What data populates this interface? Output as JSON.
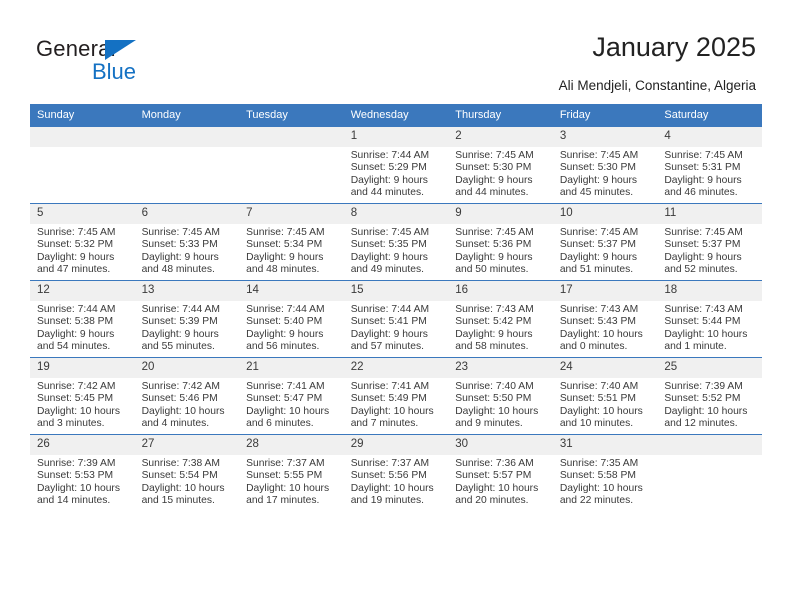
{
  "logo": {
    "word_top": "General",
    "word_bottom": "Blue",
    "triangle_icon": "triangle-icon",
    "brand_color": "#1471c3"
  },
  "header": {
    "title": "January 2025",
    "subtitle": "Ali Mendjeli, Constantine, Algeria"
  },
  "theme": {
    "header_blue": "#3b78bd",
    "daynum_band": "#f0f0f0",
    "text": "#3a3a3a"
  },
  "calendar": {
    "weekday_headers": [
      "Sunday",
      "Monday",
      "Tuesday",
      "Wednesday",
      "Thursday",
      "Friday",
      "Saturday"
    ],
    "labels": {
      "sunrise": "Sunrise:",
      "sunset": "Sunset:",
      "daylight": "Daylight:"
    },
    "weeks": [
      [
        {
          "day": ""
        },
        {
          "day": ""
        },
        {
          "day": ""
        },
        {
          "day": "1",
          "sunrise": "Sunrise: 7:44 AM",
          "sunset": "Sunset: 5:29 PM",
          "daylight_line1": "Daylight: 9 hours",
          "daylight_line2": "and 44 minutes."
        },
        {
          "day": "2",
          "sunrise": "Sunrise: 7:45 AM",
          "sunset": "Sunset: 5:30 PM",
          "daylight_line1": "Daylight: 9 hours",
          "daylight_line2": "and 44 minutes."
        },
        {
          "day": "3",
          "sunrise": "Sunrise: 7:45 AM",
          "sunset": "Sunset: 5:30 PM",
          "daylight_line1": "Daylight: 9 hours",
          "daylight_line2": "and 45 minutes."
        },
        {
          "day": "4",
          "sunrise": "Sunrise: 7:45 AM",
          "sunset": "Sunset: 5:31 PM",
          "daylight_line1": "Daylight: 9 hours",
          "daylight_line2": "and 46 minutes."
        }
      ],
      [
        {
          "day": "5",
          "sunrise": "Sunrise: 7:45 AM",
          "sunset": "Sunset: 5:32 PM",
          "daylight_line1": "Daylight: 9 hours",
          "daylight_line2": "and 47 minutes."
        },
        {
          "day": "6",
          "sunrise": "Sunrise: 7:45 AM",
          "sunset": "Sunset: 5:33 PM",
          "daylight_line1": "Daylight: 9 hours",
          "daylight_line2": "and 48 minutes."
        },
        {
          "day": "7",
          "sunrise": "Sunrise: 7:45 AM",
          "sunset": "Sunset: 5:34 PM",
          "daylight_line1": "Daylight: 9 hours",
          "daylight_line2": "and 48 minutes."
        },
        {
          "day": "8",
          "sunrise": "Sunrise: 7:45 AM",
          "sunset": "Sunset: 5:35 PM",
          "daylight_line1": "Daylight: 9 hours",
          "daylight_line2": "and 49 minutes."
        },
        {
          "day": "9",
          "sunrise": "Sunrise: 7:45 AM",
          "sunset": "Sunset: 5:36 PM",
          "daylight_line1": "Daylight: 9 hours",
          "daylight_line2": "and 50 minutes."
        },
        {
          "day": "10",
          "sunrise": "Sunrise: 7:45 AM",
          "sunset": "Sunset: 5:37 PM",
          "daylight_line1": "Daylight: 9 hours",
          "daylight_line2": "and 51 minutes."
        },
        {
          "day": "11",
          "sunrise": "Sunrise: 7:45 AM",
          "sunset": "Sunset: 5:37 PM",
          "daylight_line1": "Daylight: 9 hours",
          "daylight_line2": "and 52 minutes."
        }
      ],
      [
        {
          "day": "12",
          "sunrise": "Sunrise: 7:44 AM",
          "sunset": "Sunset: 5:38 PM",
          "daylight_line1": "Daylight: 9 hours",
          "daylight_line2": "and 54 minutes."
        },
        {
          "day": "13",
          "sunrise": "Sunrise: 7:44 AM",
          "sunset": "Sunset: 5:39 PM",
          "daylight_line1": "Daylight: 9 hours",
          "daylight_line2": "and 55 minutes."
        },
        {
          "day": "14",
          "sunrise": "Sunrise: 7:44 AM",
          "sunset": "Sunset: 5:40 PM",
          "daylight_line1": "Daylight: 9 hours",
          "daylight_line2": "and 56 minutes."
        },
        {
          "day": "15",
          "sunrise": "Sunrise: 7:44 AM",
          "sunset": "Sunset: 5:41 PM",
          "daylight_line1": "Daylight: 9 hours",
          "daylight_line2": "and 57 minutes."
        },
        {
          "day": "16",
          "sunrise": "Sunrise: 7:43 AM",
          "sunset": "Sunset: 5:42 PM",
          "daylight_line1": "Daylight: 9 hours",
          "daylight_line2": "and 58 minutes."
        },
        {
          "day": "17",
          "sunrise": "Sunrise: 7:43 AM",
          "sunset": "Sunset: 5:43 PM",
          "daylight_line1": "Daylight: 10 hours",
          "daylight_line2": "and 0 minutes."
        },
        {
          "day": "18",
          "sunrise": "Sunrise: 7:43 AM",
          "sunset": "Sunset: 5:44 PM",
          "daylight_line1": "Daylight: 10 hours",
          "daylight_line2": "and 1 minute."
        }
      ],
      [
        {
          "day": "19",
          "sunrise": "Sunrise: 7:42 AM",
          "sunset": "Sunset: 5:45 PM",
          "daylight_line1": "Daylight: 10 hours",
          "daylight_line2": "and 3 minutes."
        },
        {
          "day": "20",
          "sunrise": "Sunrise: 7:42 AM",
          "sunset": "Sunset: 5:46 PM",
          "daylight_line1": "Daylight: 10 hours",
          "daylight_line2": "and 4 minutes."
        },
        {
          "day": "21",
          "sunrise": "Sunrise: 7:41 AM",
          "sunset": "Sunset: 5:47 PM",
          "daylight_line1": "Daylight: 10 hours",
          "daylight_line2": "and 6 minutes."
        },
        {
          "day": "22",
          "sunrise": "Sunrise: 7:41 AM",
          "sunset": "Sunset: 5:49 PM",
          "daylight_line1": "Daylight: 10 hours",
          "daylight_line2": "and 7 minutes."
        },
        {
          "day": "23",
          "sunrise": "Sunrise: 7:40 AM",
          "sunset": "Sunset: 5:50 PM",
          "daylight_line1": "Daylight: 10 hours",
          "daylight_line2": "and 9 minutes."
        },
        {
          "day": "24",
          "sunrise": "Sunrise: 7:40 AM",
          "sunset": "Sunset: 5:51 PM",
          "daylight_line1": "Daylight: 10 hours",
          "daylight_line2": "and 10 minutes."
        },
        {
          "day": "25",
          "sunrise": "Sunrise: 7:39 AM",
          "sunset": "Sunset: 5:52 PM",
          "daylight_line1": "Daylight: 10 hours",
          "daylight_line2": "and 12 minutes."
        }
      ],
      [
        {
          "day": "26",
          "sunrise": "Sunrise: 7:39 AM",
          "sunset": "Sunset: 5:53 PM",
          "daylight_line1": "Daylight: 10 hours",
          "daylight_line2": "and 14 minutes."
        },
        {
          "day": "27",
          "sunrise": "Sunrise: 7:38 AM",
          "sunset": "Sunset: 5:54 PM",
          "daylight_line1": "Daylight: 10 hours",
          "daylight_line2": "and 15 minutes."
        },
        {
          "day": "28",
          "sunrise": "Sunrise: 7:37 AM",
          "sunset": "Sunset: 5:55 PM",
          "daylight_line1": "Daylight: 10 hours",
          "daylight_line2": "and 17 minutes."
        },
        {
          "day": "29",
          "sunrise": "Sunrise: 7:37 AM",
          "sunset": "Sunset: 5:56 PM",
          "daylight_line1": "Daylight: 10 hours",
          "daylight_line2": "and 19 minutes."
        },
        {
          "day": "30",
          "sunrise": "Sunrise: 7:36 AM",
          "sunset": "Sunset: 5:57 PM",
          "daylight_line1": "Daylight: 10 hours",
          "daylight_line2": "and 20 minutes."
        },
        {
          "day": "31",
          "sunrise": "Sunrise: 7:35 AM",
          "sunset": "Sunset: 5:58 PM",
          "daylight_line1": "Daylight: 10 hours",
          "daylight_line2": "and 22 minutes."
        },
        {
          "day": ""
        }
      ]
    ]
  }
}
